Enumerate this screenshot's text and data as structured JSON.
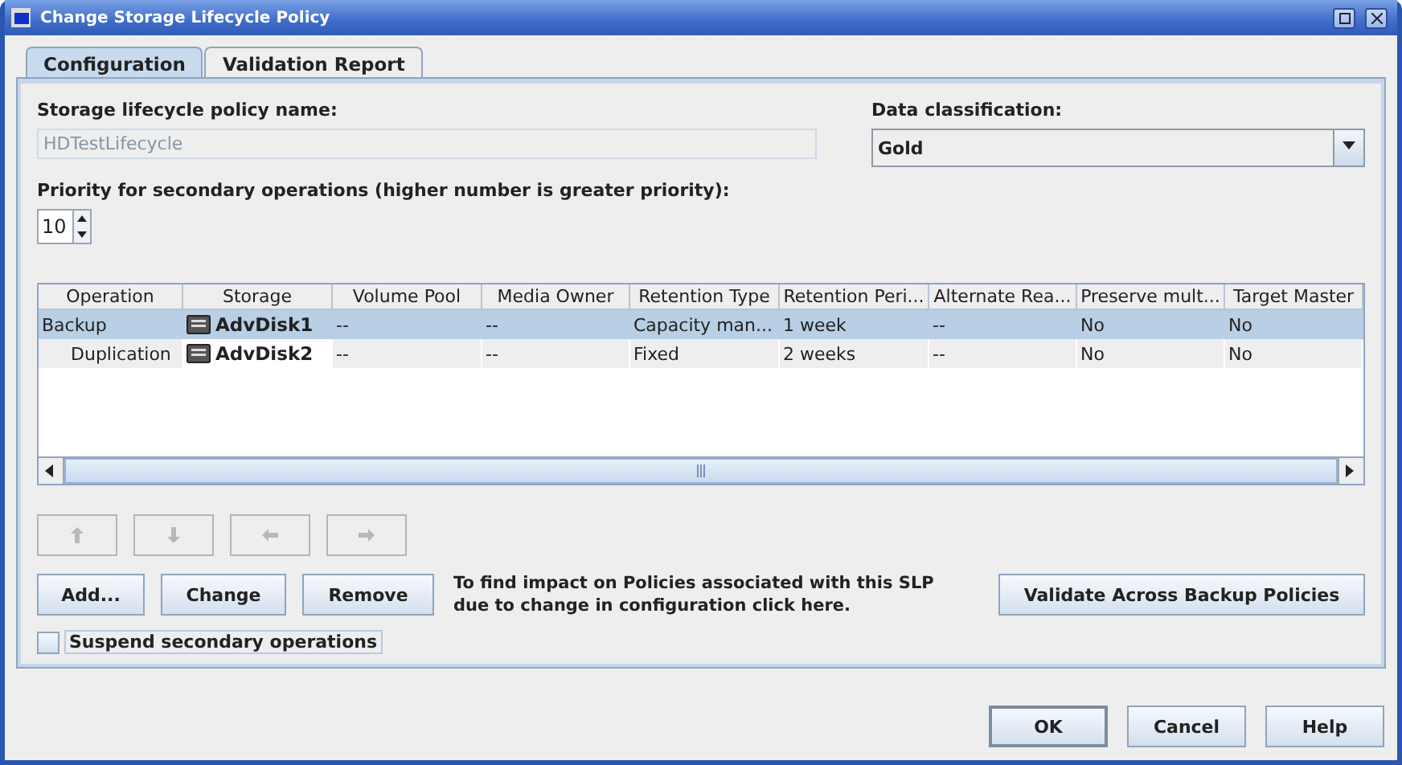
{
  "window": {
    "title": "Change Storage Lifecycle Policy"
  },
  "tabs": [
    {
      "label": "Configuration",
      "selected": true
    },
    {
      "label": "Validation Report",
      "selected": false
    }
  ],
  "policy_name": {
    "label": "Storage lifecycle policy name:",
    "value": "HDTestLifecycle",
    "disabled": true
  },
  "data_classification": {
    "label": "Data classification:",
    "value": "Gold"
  },
  "priority": {
    "label": "Priority for secondary operations (higher number is greater priority):",
    "value": "10"
  },
  "table": {
    "columns": [
      "Operation",
      "Storage",
      "Volume Pool",
      "Media Owner",
      "Retention Type",
      "Retention Peri...",
      "Alternate Rea...",
      "Preserve mult...",
      "Target Master"
    ],
    "rows": [
      {
        "selected": true,
        "cells": [
          "Backup",
          "AdvDisk1",
          "--",
          "--",
          "Capacity man...",
          "1 week",
          "--",
          "No",
          "No"
        ],
        "children": [
          {
            "selected": false,
            "cells": [
              "Duplication",
              "AdvDisk2",
              "--",
              "--",
              "Fixed",
              "2 weeks",
              "--",
              "No",
              "No"
            ]
          }
        ]
      }
    ]
  },
  "arrow_buttons": [
    {
      "kind": "up",
      "disabled": true
    },
    {
      "kind": "down",
      "disabled": true
    },
    {
      "kind": "left",
      "disabled": true
    },
    {
      "kind": "right",
      "disabled": true
    }
  ],
  "action_buttons": [
    "Add...",
    "Change",
    "Remove"
  ],
  "impact_note": "To find impact on Policies associated with this SLP due to change in configuration click here.",
  "validate_button": "Validate Across Backup Policies",
  "suspend": {
    "label": "Suspend secondary operations",
    "checked": false
  },
  "dialog_buttons": [
    "OK",
    "Cancel",
    "Help"
  ]
}
